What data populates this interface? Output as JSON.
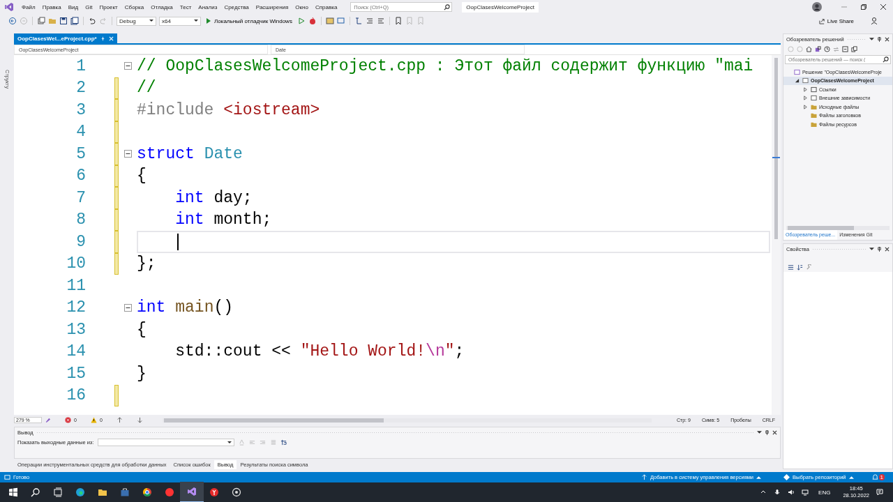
{
  "menu_bar": {
    "items": [
      "Файл",
      "Правка",
      "Вид",
      "Git",
      "Проект",
      "Сборка",
      "Отладка",
      "Тест",
      "Анализ",
      "Средства",
      "Расширения",
      "Окно",
      "Справка"
    ],
    "search": {
      "placeholder": "Поиск (Ctrl+Q)"
    },
    "title": "OopClasesWelcomeProject"
  },
  "toolbar": {
    "configuration": "Debug",
    "platform": "x64",
    "run_label": "Локальный отладчик Windows",
    "live_share": "Live Share"
  },
  "side_strip": {
    "label": "Структу"
  },
  "editor": {
    "tabs": [
      {
        "label": "OopClasesWel...eProject.cpp*",
        "selected": true
      }
    ],
    "nav": {
      "project": "OopClasesWelcomeProject",
      "symbol": "Date"
    },
    "lines": [
      {
        "number": "1",
        "changed": false,
        "fold": true,
        "current": false,
        "tokens": [
          {
            "kind": "comment",
            "text": "// OopClasesWelcomeProject.cpp : Этот файл содержит функцию \"mai"
          }
        ]
      },
      {
        "number": "2",
        "changed": true,
        "fold": false,
        "current": false,
        "tokens": [
          {
            "kind": "comment",
            "text": "//"
          }
        ]
      },
      {
        "number": "3",
        "changed": true,
        "fold": false,
        "current": false,
        "tokens": [
          {
            "kind": "preprocessor",
            "text": "#include"
          },
          {
            "kind": "string",
            "text": " <iostream>"
          }
        ]
      },
      {
        "number": "4",
        "changed": true,
        "fold": false,
        "current": false
      },
      {
        "number": "5",
        "changed": true,
        "fold": true,
        "current": false,
        "tokens": [
          {
            "kind": "keyword",
            "text": "struct "
          },
          {
            "kind": "type",
            "text": "Date"
          }
        ]
      },
      {
        "number": "6",
        "changed": true,
        "fold": false,
        "current": false,
        "tokens": [
          {
            "kind": "plain",
            "text": "{"
          }
        ]
      },
      {
        "number": "7",
        "changed": true,
        "fold": false,
        "current": false,
        "tokens": [
          {
            "kind": "keyword",
            "text": "    int"
          },
          {
            "kind": "plain",
            "text": " day;"
          }
        ]
      },
      {
        "number": "8",
        "changed": true,
        "fold": false,
        "current": false,
        "tokens": [
          {
            "kind": "keyword",
            "text": "    int"
          },
          {
            "kind": "plain",
            "text": " month;"
          }
        ]
      },
      {
        "number": "9",
        "changed": true,
        "fold": false,
        "current": true
      },
      {
        "number": "10",
        "changed": true,
        "fold": false,
        "current": false,
        "tokens": [
          {
            "kind": "plain",
            "text": "};"
          }
        ]
      },
      {
        "number": "11",
        "changed": false,
        "fold": false,
        "current": false
      },
      {
        "number": "12",
        "changed": false,
        "fold": true,
        "current": false,
        "tokens": [
          {
            "kind": "keyword",
            "text": "int "
          },
          {
            "kind": "function",
            "text": "main"
          },
          {
            "kind": "plain",
            "text": "()"
          }
        ]
      },
      {
        "number": "13",
        "changed": false,
        "fold": false,
        "current": false,
        "tokens": [
          {
            "kind": "plain",
            "text": "{"
          }
        ]
      },
      {
        "number": "14",
        "changed": false,
        "fold": false,
        "current": false,
        "tokens": [
          {
            "kind": "plain",
            "text": "    std::cout << "
          },
          {
            "kind": "string",
            "text": "\"Hello World!"
          },
          {
            "kind": "escape",
            "text": "\\n"
          },
          {
            "kind": "string",
            "text": "\""
          },
          {
            "kind": "plain",
            "text": ";"
          }
        ]
      },
      {
        "number": "15",
        "changed": false,
        "fold": false,
        "current": false,
        "tokens": [
          {
            "kind": "plain",
            "text": "}"
          }
        ]
      },
      {
        "number": "16",
        "changed": true,
        "fold": false,
        "current": false
      }
    ],
    "status": {
      "zoom": "279 %",
      "errors": "0",
      "warnings": "0",
      "line": "Стр: 9",
      "char": "Симв: 5",
      "spaces": "Пробелы",
      "eol": "CRLF"
    }
  },
  "output": {
    "title": "Вывод",
    "source_label": "Показать выходные данные из:"
  },
  "bottom_tabs": [
    {
      "label": "Операции инструментальных средств для обработки данных",
      "selected": false
    },
    {
      "label": "Список ошибок",
      "selected": false
    },
    {
      "label": "Вывод",
      "selected": true
    },
    {
      "label": "Результаты поиска символа",
      "selected": false
    }
  ],
  "solution_explorer": {
    "title": "Обозреватель решений",
    "search": {
      "placeholder": "Обозреватель решений — поиск ("
    },
    "tree": [
      {
        "kind": "solution",
        "label": "Решение \"OopClasesWelcomeProje",
        "selected": false,
        "children": [
          {
            "kind": "project",
            "label": "OopClasesWelcomeProject",
            "selected": true,
            "expanded": true,
            "children": [
              {
                "kind": "references",
                "label": "Ссылки",
                "selected": false,
                "expanded": false
              },
              {
                "kind": "dependencies",
                "label": "Внешние зависимости",
                "selected": false,
                "expanded": false
              },
              {
                "kind": "folder",
                "label": "Исходные файлы",
                "selected": false,
                "expanded": false
              },
              {
                "kind": "folder",
                "label": "Файлы заголовков",
                "selected": false
              },
              {
                "kind": "folder",
                "label": "Файлы ресурсов",
                "selected": false
              }
            ]
          }
        ]
      }
    ],
    "tabs": [
      {
        "label": "Обозреватель реше...",
        "selected": true
      },
      {
        "label": "Изменения Git",
        "selected": false
      }
    ]
  },
  "properties": {
    "title": "Свойства"
  },
  "status_bar": {
    "text": "Готово",
    "source_control": "Добавить в систему управления версиями",
    "repository": "Выбрать репозиторий",
    "notifications": "1"
  },
  "taskbar": {
    "language": "ENG",
    "time": "18:45",
    "date": "28.10.2022"
  }
}
